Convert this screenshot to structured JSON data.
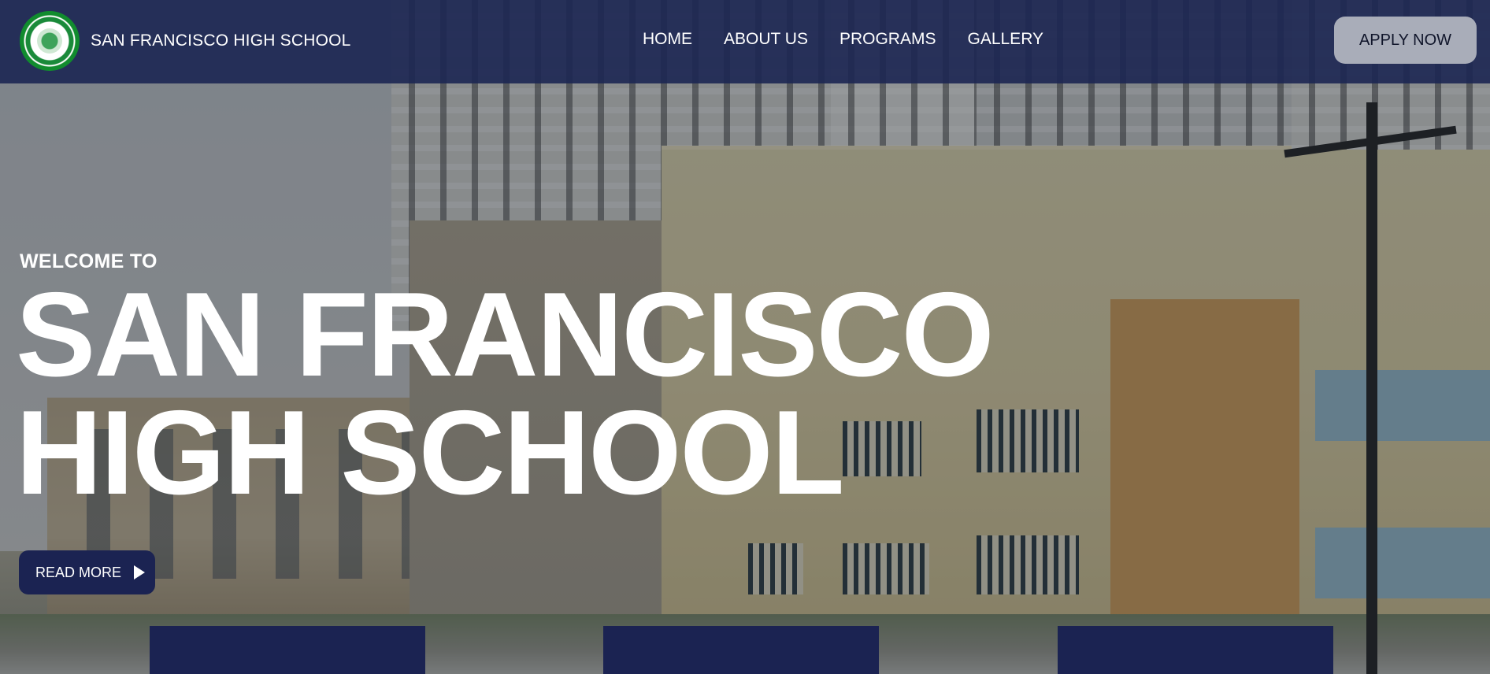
{
  "header": {
    "school_name": "SAN FRANCISCO HIGH SCHOOL",
    "nav": [
      "HOME",
      "ABOUT US",
      "PROGRAMS",
      "GALLERY"
    ],
    "apply_label": "APPLY NOW"
  },
  "hero": {
    "welcome": "WELCOME TO",
    "title_line1": "SAN FRANCISCO",
    "title_line2": "HIGH SCHOOL",
    "read_more_label": "READ MORE"
  },
  "colors": {
    "navbar": "#1c2652",
    "button_dark": "#1b2352",
    "apply_button": "#a9adb9",
    "text": "#ffffff"
  },
  "icons": {
    "logo": "school-seal-icon",
    "read_more": "play-icon"
  }
}
